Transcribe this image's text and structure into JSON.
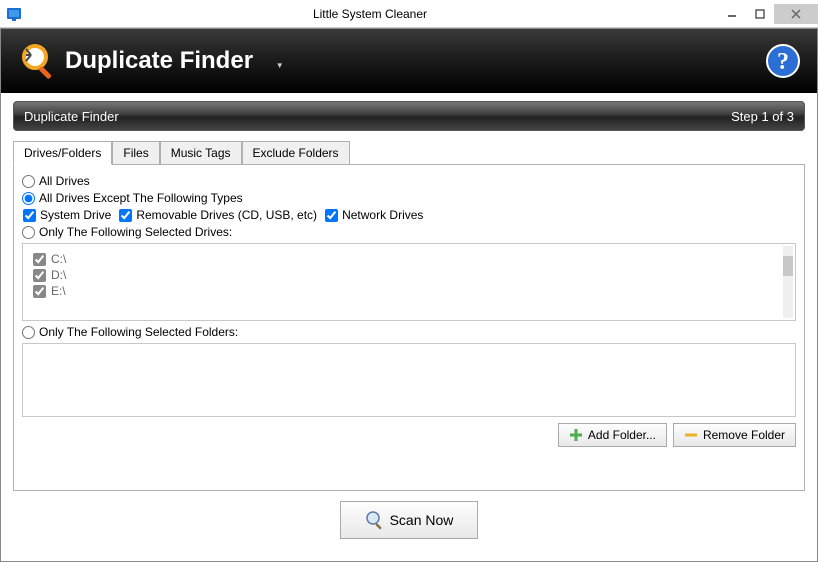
{
  "window": {
    "title": "Little System Cleaner"
  },
  "banner": {
    "title": "Duplicate Finder"
  },
  "stepbar": {
    "title": "Duplicate Finder",
    "progress": "Step 1 of 3"
  },
  "tabs": [
    "Drives/Folders",
    "Files",
    "Music Tags",
    "Exclude Folders"
  ],
  "options": {
    "allDrives": "All Drives",
    "exceptTypes": "All Drives Except The Following Types",
    "systemDrive": "System Drive",
    "removable": "Removable Drives (CD, USB, etc)",
    "network": "Network Drives",
    "selectedDrives": "Only The Following Selected Drives:",
    "selectedFolders": "Only The Following Selected Folders:"
  },
  "drives": [
    "C:\\",
    "D:\\",
    "E:\\"
  ],
  "buttons": {
    "addFolder": "Add Folder...",
    "removeFolder": "Remove Folder",
    "scan": "Scan Now"
  }
}
